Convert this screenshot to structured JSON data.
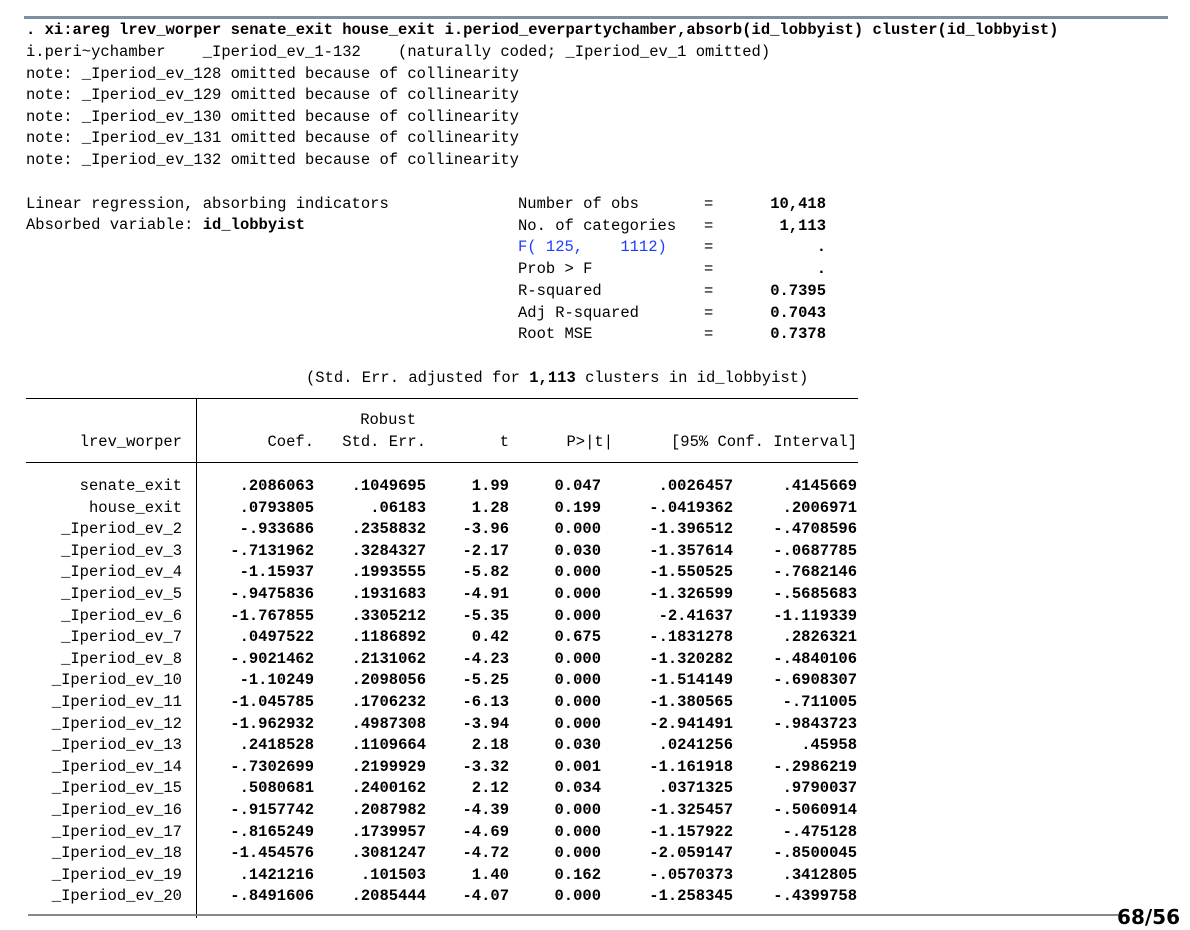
{
  "command": ". xi:areg lrev_worper senate_exit house_exit i.period_everpartychamber,absorb(id_lobbyist) cluster(id_lobbyist)",
  "notes": [
    "i.peri~ychamber    _Iperiod_ev_1-132    (naturally coded; _Iperiod_ev_1 omitted)",
    "note: _Iperiod_ev_128 omitted because of collinearity",
    "note: _Iperiod_ev_129 omitted because of collinearity",
    "note: _Iperiod_ev_130 omitted because of collinearity",
    "note: _Iperiod_ev_131 omitted because of collinearity",
    "note: _Iperiod_ev_132 omitted because of collinearity"
  ],
  "header": {
    "model": "Linear regression, absorbing indicators",
    "absorbed_label": "Absorbed variable: ",
    "absorbed_var": "id_lobbyist"
  },
  "stats": [
    {
      "label": "Number of obs",
      "eq": "=",
      "value": "10,418",
      "blue": false
    },
    {
      "label": "No. of categories",
      "eq": "=",
      "value": "1,113",
      "blue": false
    },
    {
      "label": "F( 125,    1112)",
      "eq": "=",
      "value": ".",
      "blue": true
    },
    {
      "label": "Prob > F",
      "eq": "=",
      "value": ".",
      "blue": false
    },
    {
      "label": "R-squared",
      "eq": "=",
      "value": "0.7395",
      "blue": false
    },
    {
      "label": "Adj R-squared",
      "eq": "=",
      "value": "0.7043",
      "blue": false
    },
    {
      "label": "Root MSE",
      "eq": "=",
      "value": "0.7378",
      "blue": false
    }
  ],
  "cluster_note": {
    "prefix": "(Std. Err. adjusted for ",
    "count": "1,113",
    "suffix": " clusters in id_lobbyist)"
  },
  "table": {
    "depvar": "lrev_worper",
    "headers_top": {
      "robust": "Robust"
    },
    "headers": [
      "Coef.",
      "Std. Err.",
      "t",
      "P>|t|",
      "[95% Conf. Interval]"
    ],
    "rows": [
      {
        "name": "senate_exit",
        "coef": ".2086063",
        "se": ".1049695",
        "t": "1.99",
        "p": "0.047",
        "lo": ".0026457",
        "hi": ".4145669"
      },
      {
        "name": "house_exit",
        "coef": ".0793805",
        "se": ".06183",
        "t": "1.28",
        "p": "0.199",
        "lo": "-.0419362",
        "hi": ".2006971"
      },
      {
        "name": "_Iperiod_ev_2",
        "coef": "-.933686",
        "se": ".2358832",
        "t": "-3.96",
        "p": "0.000",
        "lo": "-1.396512",
        "hi": "-.4708596"
      },
      {
        "name": "_Iperiod_ev_3",
        "coef": "-.7131962",
        "se": ".3284327",
        "t": "-2.17",
        "p": "0.030",
        "lo": "-1.357614",
        "hi": "-.0687785"
      },
      {
        "name": "_Iperiod_ev_4",
        "coef": "-1.15937",
        "se": ".1993555",
        "t": "-5.82",
        "p": "0.000",
        "lo": "-1.550525",
        "hi": "-.7682146"
      },
      {
        "name": "_Iperiod_ev_5",
        "coef": "-.9475836",
        "se": ".1931683",
        "t": "-4.91",
        "p": "0.000",
        "lo": "-1.326599",
        "hi": "-.5685683"
      },
      {
        "name": "_Iperiod_ev_6",
        "coef": "-1.767855",
        "se": ".3305212",
        "t": "-5.35",
        "p": "0.000",
        "lo": "-2.41637",
        "hi": "-1.119339"
      },
      {
        "name": "_Iperiod_ev_7",
        "coef": ".0497522",
        "se": ".1186892",
        "t": "0.42",
        "p": "0.675",
        "lo": "-.1831278",
        "hi": ".2826321"
      },
      {
        "name": "_Iperiod_ev_8",
        "coef": "-.9021462",
        "se": ".2131062",
        "t": "-4.23",
        "p": "0.000",
        "lo": "-1.320282",
        "hi": "-.4840106"
      },
      {
        "name": "_Iperiod_ev_10",
        "coef": "-1.10249",
        "se": ".2098056",
        "t": "-5.25",
        "p": "0.000",
        "lo": "-1.514149",
        "hi": "-.6908307"
      },
      {
        "name": "_Iperiod_ev_11",
        "coef": "-1.045785",
        "se": ".1706232",
        "t": "-6.13",
        "p": "0.000",
        "lo": "-1.380565",
        "hi": "-.711005"
      },
      {
        "name": "_Iperiod_ev_12",
        "coef": "-1.962932",
        "se": ".4987308",
        "t": "-3.94",
        "p": "0.000",
        "lo": "-2.941491",
        "hi": "-.9843723"
      },
      {
        "name": "_Iperiod_ev_13",
        "coef": ".2418528",
        "se": ".1109664",
        "t": "2.18",
        "p": "0.030",
        "lo": ".0241256",
        "hi": ".45958"
      },
      {
        "name": "_Iperiod_ev_14",
        "coef": "-.7302699",
        "se": ".2199929",
        "t": "-3.32",
        "p": "0.001",
        "lo": "-1.161918",
        "hi": "-.2986219"
      },
      {
        "name": "_Iperiod_ev_15",
        "coef": ".5080681",
        "se": ".2400162",
        "t": "2.12",
        "p": "0.034",
        "lo": ".0371325",
        "hi": ".9790037"
      },
      {
        "name": "_Iperiod_ev_16",
        "coef": "-.9157742",
        "se": ".2087982",
        "t": "-4.39",
        "p": "0.000",
        "lo": "-1.325457",
        "hi": "-.5060914"
      },
      {
        "name": "_Iperiod_ev_17",
        "coef": "-.8165249",
        "se": ".1739957",
        "t": "-4.69",
        "p": "0.000",
        "lo": "-1.157922",
        "hi": "-.475128"
      },
      {
        "name": "_Iperiod_ev_18",
        "coef": "-1.454576",
        "se": ".3081247",
        "t": "-4.72",
        "p": "0.000",
        "lo": "-2.059147",
        "hi": "-.8500045"
      },
      {
        "name": "_Iperiod_ev_19",
        "coef": ".1421216",
        "se": ".101503",
        "t": "1.40",
        "p": "0.162",
        "lo": "-.0570373",
        "hi": ".3412805"
      },
      {
        "name": "_Iperiod_ev_20",
        "coef": "-.8491606",
        "se": ".2085444",
        "t": "-4.07",
        "p": "0.000",
        "lo": "-1.258345",
        "hi": "-.4399758"
      }
    ]
  },
  "page_number": "68/56"
}
